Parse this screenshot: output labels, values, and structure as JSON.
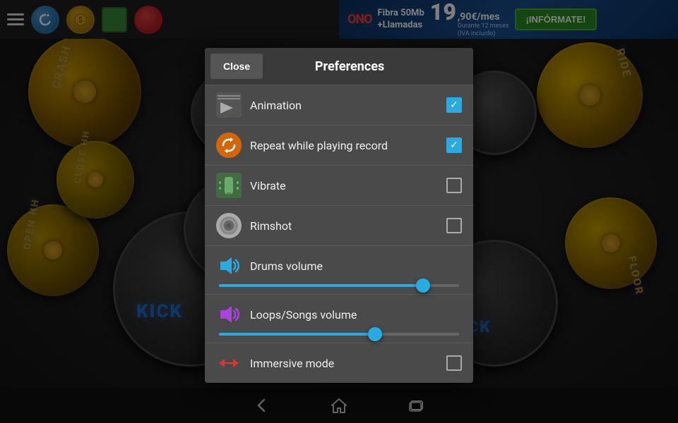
{
  "toolbar": {
    "refresh_icon": "↻",
    "coin_icon": "●",
    "green_btn": "▬",
    "red_btn": "●"
  },
  "ad": {
    "brand": "ONO",
    "brand_accent": "●",
    "fiber": "Fibra 50Mb",
    "calls": "+Llamadas",
    "price_integer": "19",
    "price_decimal": ",90€/mes",
    "price_note": "Durante 12 meses",
    "price_note2": "(IVA incluido)",
    "cta": "¡INFÓRMATE!"
  },
  "nav": {
    "back_icon": "←",
    "home_icon": "⌂",
    "recent_icon": "▭"
  },
  "preferences": {
    "title": "Preferences",
    "close_label": "Close",
    "items": [
      {
        "id": "animation",
        "label": "Animation",
        "checked": true,
        "has_slider": false
      },
      {
        "id": "repeat",
        "label": "Repeat while playing record",
        "checked": true,
        "has_slider": false
      },
      {
        "id": "vibrate",
        "label": "Vibrate",
        "checked": false,
        "has_slider": false
      },
      {
        "id": "rimshot",
        "label": "Rimshot",
        "checked": false,
        "has_slider": false
      },
      {
        "id": "drums_volume",
        "label": "Drums volume",
        "is_slider": true,
        "slider_value": 85
      },
      {
        "id": "loops_volume",
        "label": "Loops/Songs volume",
        "is_slider": true,
        "slider_value": 65
      },
      {
        "id": "immersive",
        "label": "Immersive mode",
        "checked": false,
        "has_slider": false
      }
    ]
  },
  "labels": {
    "crash": "CRASH",
    "ride": "RIDE",
    "close_hh": "CLOSE HH",
    "open_hh": "OPEN HH",
    "floor": "FLOOR",
    "kick1": "KICK",
    "kick2": "KICK"
  },
  "colors": {
    "accent": "#29aae1",
    "accent_purple": "#aa44dd",
    "accent_red": "#dd3333",
    "checked": "#29aae1",
    "toolbar_bg": "#1e1e1e",
    "panel_bg": "#4a4a4a",
    "header_bg": "#3a3a3a"
  }
}
